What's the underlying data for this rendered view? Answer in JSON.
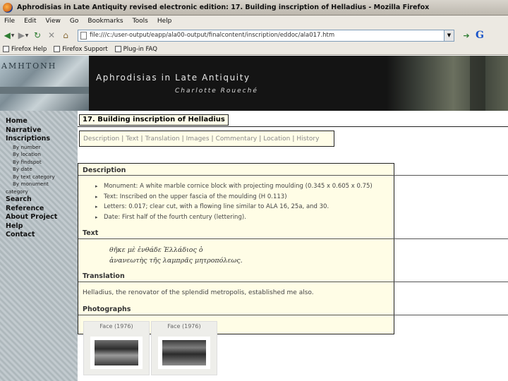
{
  "window": {
    "title": "Aphrodisias in Late Antiquity revised electronic edition: 17. Building inscription of Helladius - Mozilla Firefox"
  },
  "menubar": [
    "File",
    "Edit",
    "View",
    "Go",
    "Bookmarks",
    "Tools",
    "Help"
  ],
  "navbar": {
    "url": "file:///c:/user-output/eapp/ala00-output/finalcontent/inscription/eddoc/ala017.htm",
    "search_engine_icon": "google-icon"
  },
  "bookmarks": [
    "Firefox Help",
    "Firefox Support",
    "Plug-in FAQ"
  ],
  "header": {
    "title": "Aphrodisias in Late Antiquity",
    "subtitle": "Charlotte Roueché",
    "stone_text": "ΑΜΗΤΟΝΗ"
  },
  "sidebar": {
    "home": "Home",
    "narrative": "Narrative",
    "inscriptions": "Inscriptions",
    "sub": [
      "By number",
      "By location",
      "By findspot",
      "By date",
      "By text category",
      "By monument"
    ],
    "sub_wrap": "category",
    "search": "Search",
    "reference": "Reference",
    "about": "About Project",
    "help": "Help",
    "contact": "Contact"
  },
  "page": {
    "title": "17. Building inscription of Helladius",
    "tabs": [
      "Description",
      "Text",
      "Translation",
      "Images",
      "Commentary",
      "Location",
      "History"
    ]
  },
  "description": {
    "heading": "Description",
    "bullets": [
      "Monument: A white marble cornice block with projecting moulding (0.345 x 0.605 x 0.75)",
      "Text: Inscribed on the upper fascia of the moulding (H 0.113)",
      "Letters: 0.017; clear cut, with a flowing line similar to ALA 16, 25a, and 30.",
      "Date: First half of the fourth century (lettering)."
    ]
  },
  "text_section": {
    "heading": "Text",
    "lines": [
      "θῆκε μὲ ἐνθάδε Ἑλλάδιος ὁ",
      "ἀνανεωτὴς τῆς λαμπρᾶς μητροπόλεως."
    ]
  },
  "translation": {
    "heading": "Translation",
    "text": "Helladius, the renovator of the splendid metropolis, established me also."
  },
  "photographs": {
    "heading": "Photographs",
    "items": [
      {
        "caption": "Face (1976)"
      },
      {
        "caption": "Face (1976)"
      }
    ]
  }
}
